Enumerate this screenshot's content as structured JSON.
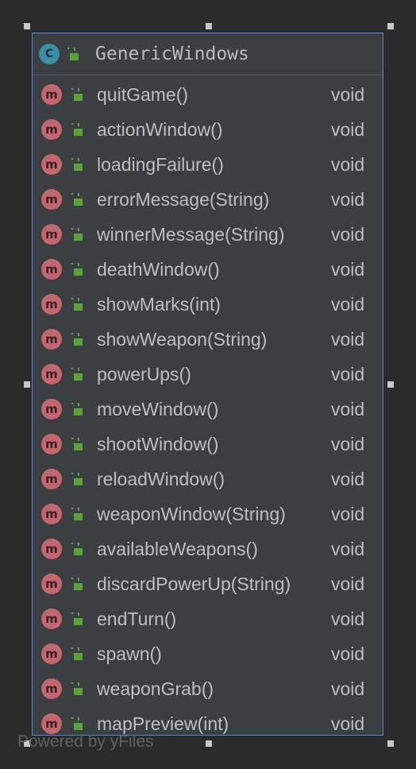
{
  "class": {
    "name": "GenericWindows",
    "icon_letter": "C",
    "icon_color": "#3a8ea8",
    "border_color": "#4a8ad8"
  },
  "method_icon_letter": "m",
  "method_icon_color": "#c2676f",
  "visibility_icon": "public-lock-icon",
  "methods": [
    {
      "name": "quitGame()",
      "type": "void"
    },
    {
      "name": "actionWindow()",
      "type": "void"
    },
    {
      "name": "loadingFailure()",
      "type": "void"
    },
    {
      "name": "errorMessage(String)",
      "type": "void"
    },
    {
      "name": "winnerMessage(String)",
      "type": "void"
    },
    {
      "name": "deathWindow()",
      "type": "void"
    },
    {
      "name": "showMarks(int)",
      "type": "void"
    },
    {
      "name": "showWeapon(String)",
      "type": "void"
    },
    {
      "name": "powerUps()",
      "type": "void"
    },
    {
      "name": "moveWindow()",
      "type": "void"
    },
    {
      "name": "shootWindow()",
      "type": "void"
    },
    {
      "name": "reloadWindow()",
      "type": "void"
    },
    {
      "name": "weaponWindow(String)",
      "type": "void"
    },
    {
      "name": "availableWeapons()",
      "type": "void"
    },
    {
      "name": "discardPowerUp(String)",
      "type": "void"
    },
    {
      "name": "endTurn()",
      "type": "void"
    },
    {
      "name": "spawn()",
      "type": "void"
    },
    {
      "name": "weaponGrab()",
      "type": "void"
    },
    {
      "name": "mapPreview(int)",
      "type": "void"
    }
  ],
  "watermark": "Powered by yFiles"
}
